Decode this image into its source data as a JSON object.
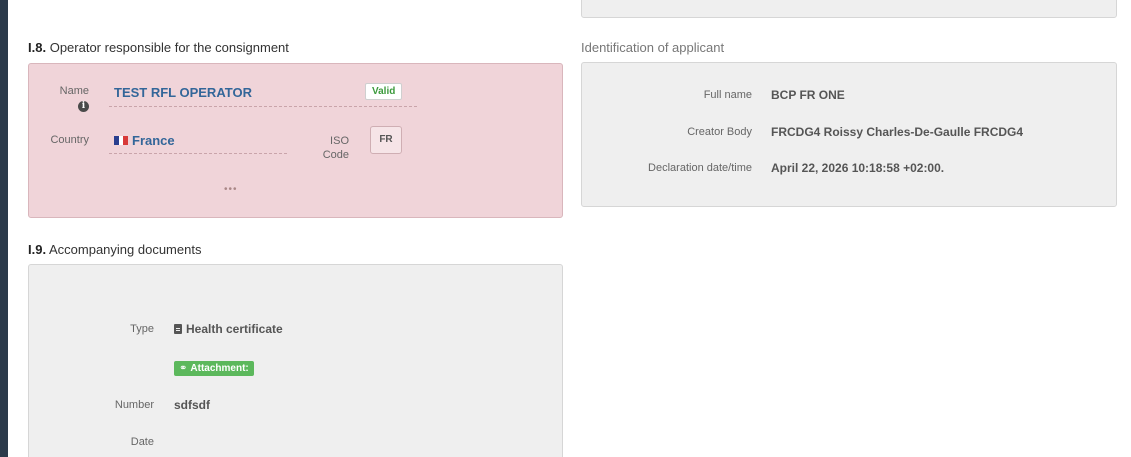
{
  "operator_section": {
    "number": "I.8.",
    "title": "Operator responsible for the consignment",
    "name_label": "Name",
    "name_value": "TEST RFL OPERATOR",
    "status_badge": "Valid",
    "country_label": "Country",
    "country_value": "France",
    "iso_label_1": "ISO",
    "iso_label_2": "Code",
    "iso_value": "FR",
    "more": "•••"
  },
  "applicant_section": {
    "title": "Identification of applicant",
    "full_name_label": "Full name",
    "full_name_value": "BCP FR ONE",
    "creator_label": "Creator Body",
    "creator_value": "FRCDG4 Roissy Charles-De-Gaulle FRCDG4",
    "decl_label": "Declaration date/time",
    "decl_value": "April 22, 2026 10:18:58 +02:00."
  },
  "documents_section": {
    "number": "I.9.",
    "title": "Accompanying documents",
    "type_label": "Type",
    "type_value": "Health certificate",
    "attachment_label": "Attachment:",
    "number_label": "Number",
    "number_value": "sdfsdf",
    "date_label": "Date"
  },
  "colors": {
    "flag_blue": "#2a3f8f",
    "flag_white": "#ffffff",
    "flag_red": "#d83a3a",
    "link_blue": "#336699",
    "valid_green": "#3c9a3c",
    "attachment_green": "#5cb85c"
  },
  "icons": {
    "info": "info-icon",
    "flag": "france-flag-icon",
    "document": "document-icon",
    "paperclip": "paperclip-icon"
  }
}
